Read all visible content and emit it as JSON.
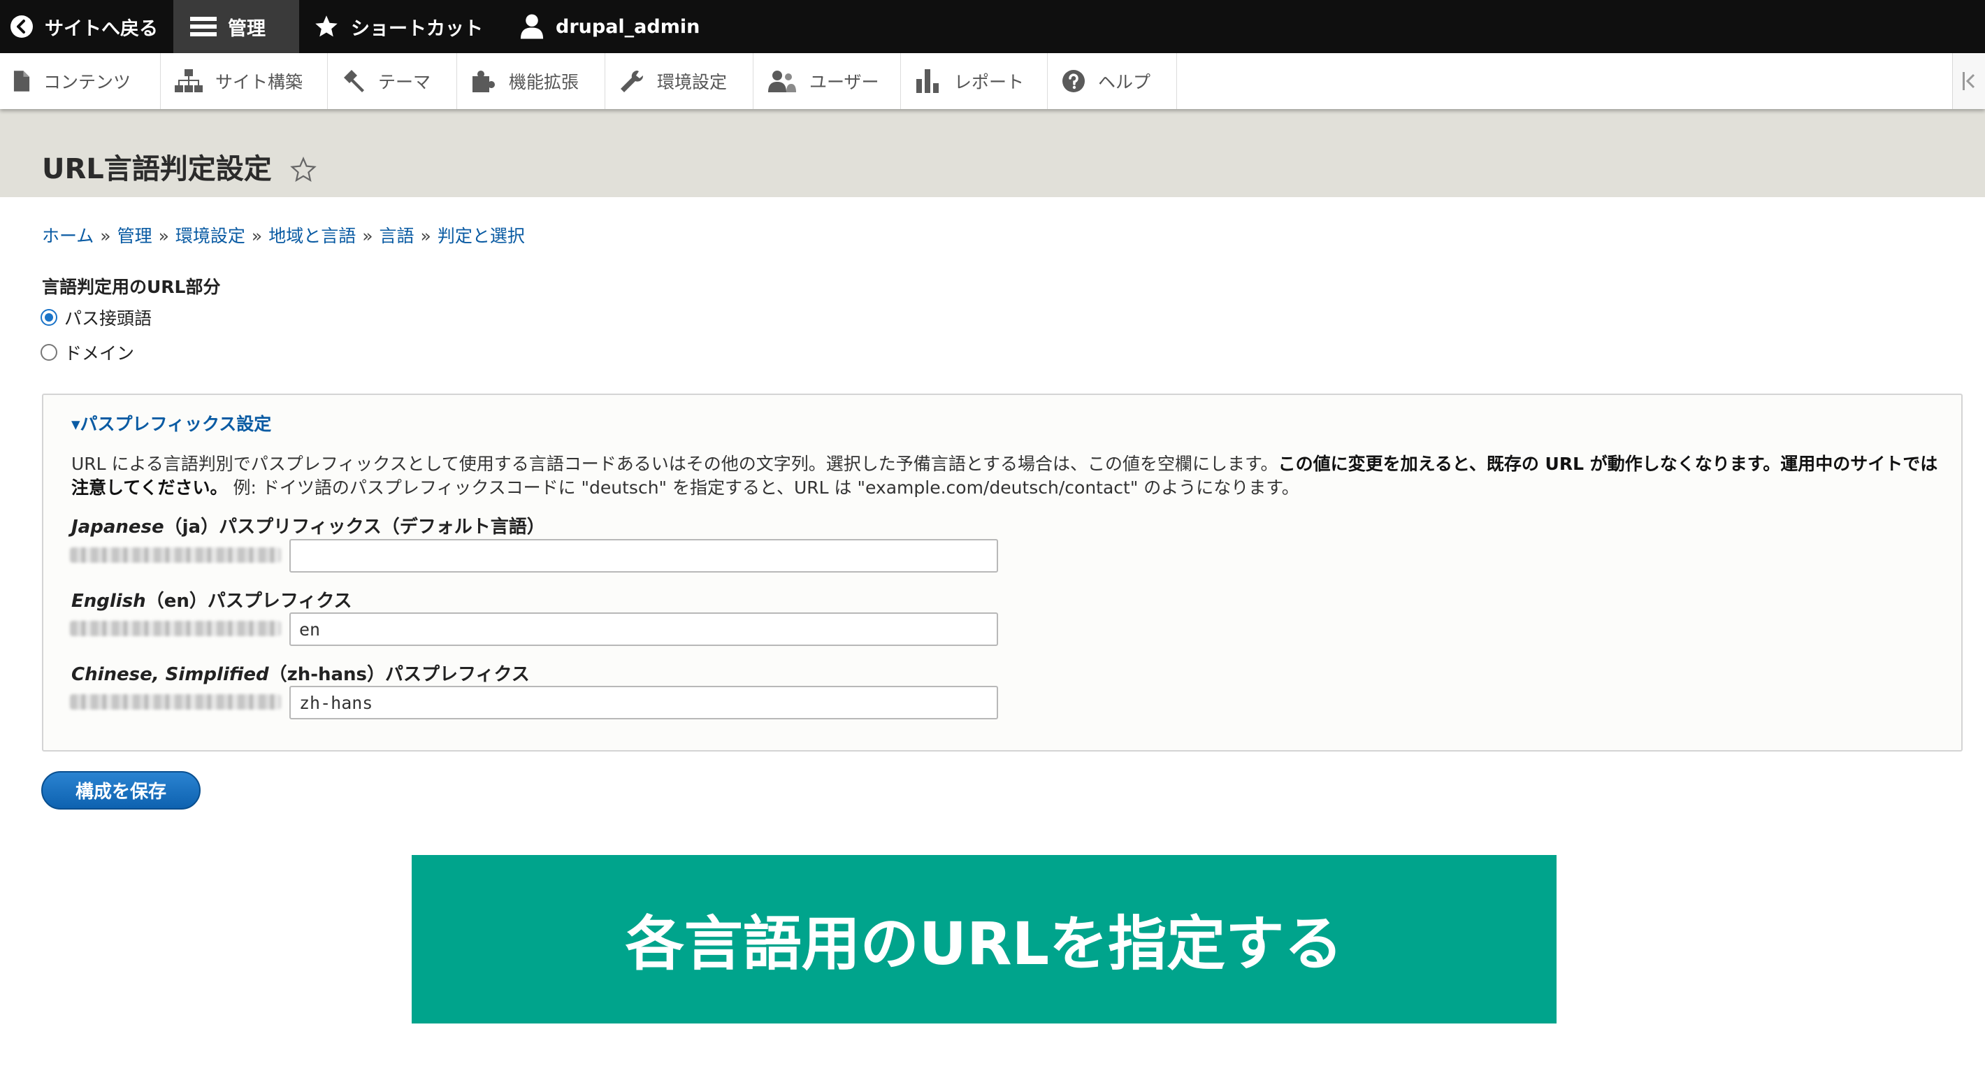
{
  "toolbar": {
    "back_label": "サイトへ戻る",
    "manage_label": "管理",
    "shortcuts_label": "ショートカット",
    "user_label": "drupal_admin"
  },
  "tray": {
    "items": [
      {
        "label": "コンテンツ",
        "icon": "file-icon"
      },
      {
        "label": "サイト構築",
        "icon": "sitemap-icon"
      },
      {
        "label": "テーマ",
        "icon": "paintbrush-icon"
      },
      {
        "label": "機能拡張",
        "icon": "puzzle-icon"
      },
      {
        "label": "環境設定",
        "icon": "wrench-icon"
      },
      {
        "label": "ユーザー",
        "icon": "people-icon"
      },
      {
        "label": "レポート",
        "icon": "bar-chart-icon"
      },
      {
        "label": "ヘルプ",
        "icon": "help-icon"
      }
    ]
  },
  "page": {
    "title": "URL言語判定設定"
  },
  "breadcrumb": [
    "ホーム",
    "管理",
    "環境設定",
    "地域と言語",
    "言語",
    "判定と選択"
  ],
  "part": {
    "label": "言語判定用のURL部分",
    "options": [
      "パス接頭語",
      "ドメイン"
    ],
    "selected": "パス接頭語"
  },
  "prefix": {
    "legend": "▾パスプレフィックス設定",
    "desc_normal": "URL による言語判別でパスプレフィックスとして使用する言語コードあるいはその他の文字列。選択した予備言語とする場合は、この値を空欄にします。",
    "desc_bold": "この値に変更を加えると、既存の URL が動作しなくなります。運用中のサイトでは注意してください。",
    "desc_example": " 例: ドイツ語のパスプレフィックスコードに \"deutsch\" を指定すると、URL は \"example.com/deutsch/contact\" のようになります。",
    "fields": [
      {
        "lang": "Japanese",
        "paren": "（ja）",
        "suffix": "パスプリフィックス（デフォルト言語）",
        "value": ""
      },
      {
        "lang": "English",
        "paren": "（en）",
        "suffix": "パスプレフィクス",
        "value": "en"
      },
      {
        "lang": "Chinese, Simplified",
        "paren": "（zh-hans）",
        "suffix": "パスプレフィクス",
        "value": "zh-hans"
      }
    ]
  },
  "actions": {
    "save_label": "構成を保存"
  },
  "banner": {
    "text": "各言語用のURLを指定する"
  },
  "colors": {
    "toolbar_bg": "#0f0f0f",
    "header_band": "#e1e0d9",
    "link": "#0a5ba3",
    "primary_button": "#1a6fc0",
    "banner": "#00a48c"
  }
}
